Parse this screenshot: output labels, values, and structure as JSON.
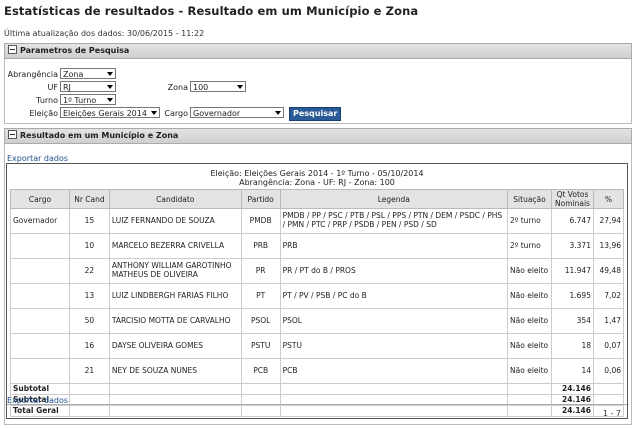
{
  "page": {
    "title": "Estatísticas de resultados - Resultado em um Município e Zona",
    "last_update": "Última atualização dos dados: 30/06/2015 - 11:22"
  },
  "params_panel": {
    "header": "Parametros de Pesquisa",
    "abrangencia_label": "Abrangência",
    "abrangencia_value": "Zona",
    "uf_label": "UF",
    "uf_value": "RJ",
    "zona_label": "Zona",
    "zona_value": "100",
    "turno_label": "Turno",
    "turno_value": "1º Turno",
    "eleicao_label": "Eleição",
    "eleicao_value": "Eleições Gerais 2014",
    "cargo_label": "Cargo",
    "cargo_value": "Governador",
    "search_button": "Pesquisar"
  },
  "results_panel": {
    "header": "Resultado em um Município e Zona",
    "export_top": "Exportar dados",
    "export_bottom": "Exportar dados",
    "caption_line1": "Eleição: Eleições Gerais 2014 - 1º Turno - 05/10/2014",
    "caption_line2": "Abrangência: Zona - UF: RJ - Zona: 100",
    "columns": [
      "Cargo",
      "Nr Cand",
      "Candidato",
      "Partido",
      "Legenda",
      "Situação",
      "Qt Votos Nominais",
      "%"
    ],
    "rows": [
      [
        "Governador",
        "15",
        "LUIZ FERNANDO DE SOUZA",
        "PMDB",
        "PMDB / PP / PSC / PTB / PSL / PPS / PTN / DEM / PSDC / PHS / PMN / PTC / PRP / PSDB / PEN / PSD / SD",
        "2º turno",
        "6.747",
        "27,94"
      ],
      [
        "",
        "10",
        "MARCELO BEZERRA CRIVELLA",
        "PRB",
        "PRB",
        "2º turno",
        "3.371",
        "13,96"
      ],
      [
        "",
        "22",
        "ANTHONY WILLIAM GAROTINHO MATHEUS DE OLIVEIRA",
        "PR",
        "PR / PT do B / PROS",
        "Não eleito",
        "11.947",
        "49,48"
      ],
      [
        "",
        "13",
        "LUIZ LINDBERGH FARIAS FILHO",
        "PT",
        "PT / PV / PSB / PC do B",
        "Não eleito",
        "1.695",
        "7,02"
      ],
      [
        "",
        "50",
        "TARCISIO MOTTA DE CARVALHO",
        "PSOL",
        "PSOL",
        "Não eleito",
        "354",
        "1,47"
      ],
      [
        "",
        "16",
        "DAYSE OLIVEIRA GOMES",
        "PSTU",
        "PSTU",
        "Não eleito",
        "18",
        "0,07"
      ],
      [
        "",
        "21",
        "NEY DE SOUZA NUNES",
        "PCB",
        "PCB",
        "Não eleito",
        "14",
        "0,06"
      ]
    ],
    "summaries": [
      [
        "Subtotal",
        "24.146"
      ],
      [
        "Subtotal",
        "24.146"
      ],
      [
        "Total Geral",
        "24.146"
      ]
    ],
    "pager": "1 - 7"
  }
}
